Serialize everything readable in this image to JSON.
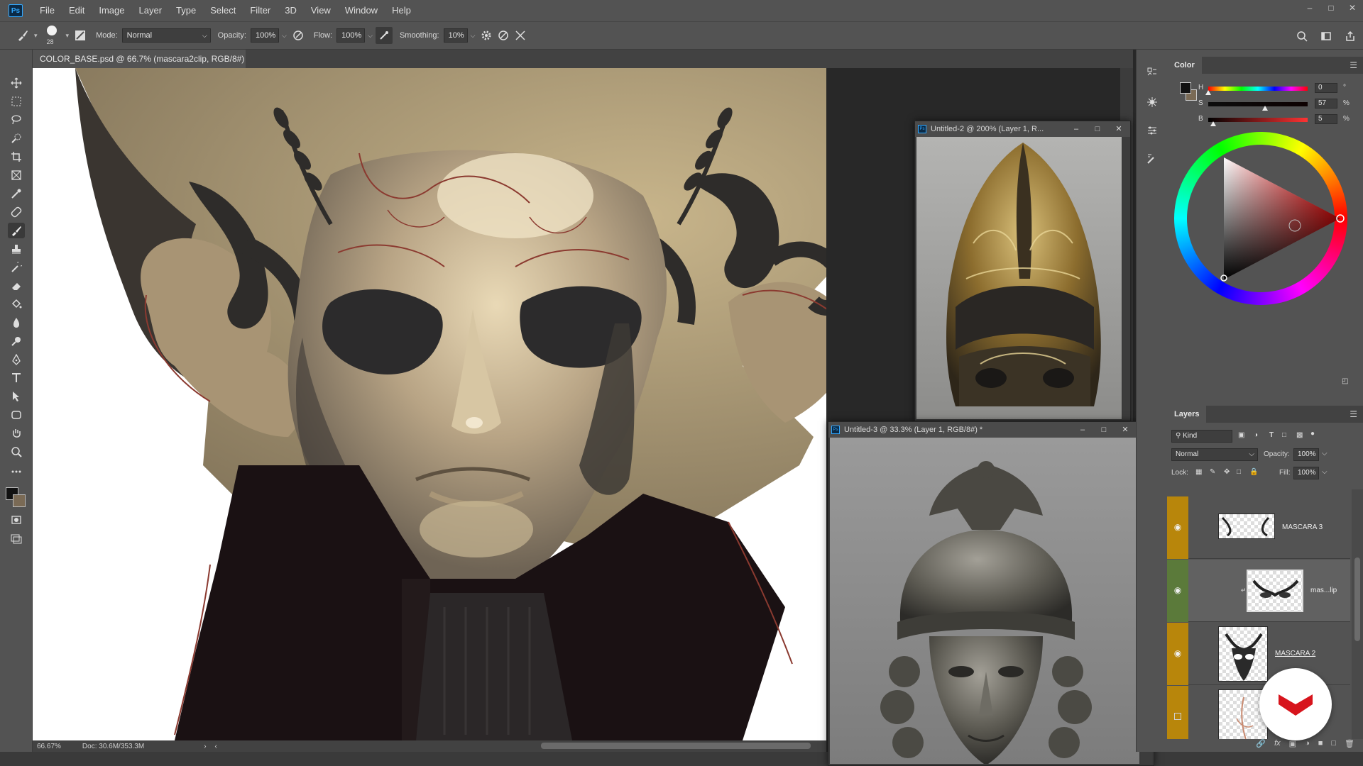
{
  "menubar": {
    "app_logo": "Ps",
    "items": [
      "File",
      "Edit",
      "Image",
      "Layer",
      "Type",
      "Select",
      "Filter",
      "3D",
      "View",
      "Window",
      "Help"
    ]
  },
  "options": {
    "brush_size": "28",
    "mode_label": "Mode:",
    "mode_value": "Normal",
    "opacity_label": "Opacity:",
    "opacity_value": "100%",
    "flow_label": "Flow:",
    "flow_value": "100%",
    "smoothing_label": "Smoothing:",
    "smoothing_value": "10%"
  },
  "document": {
    "tab_title": "COLOR_BASE.psd @ 66.7% (mascara2clip, RGB/8#) *",
    "zoom": "66.67%",
    "doc_size": "Doc: 30.6M/353.3M"
  },
  "ref_windows": [
    {
      "title": "Untitled-2 @ 200% (Layer 1, R..."
    },
    {
      "title": "Untitled-3 @ 33.3% (Layer 1, RGB/8#) *"
    }
  ],
  "color_panel": {
    "tab": "Color",
    "h": {
      "label": "H",
      "value": "0",
      "unit": "°",
      "fraction": 0.0
    },
    "s": {
      "label": "S",
      "value": "57",
      "unit": "%",
      "fraction": 0.57
    },
    "b": {
      "label": "B",
      "value": "5",
      "unit": "%",
      "fraction": 0.05
    },
    "fg_color": "#111111",
    "bg_color": "#7a6a55"
  },
  "layers_panel": {
    "tab": "Layers",
    "filter_kind": "Kind",
    "blend_mode": "Normal",
    "opacity_label": "Opacity:",
    "opacity_value": "100%",
    "lock_label": "Lock:",
    "fill_label": "Fill:",
    "fill_value": "100%",
    "layers": [
      {
        "name": "MASCARA 3",
        "visible": true,
        "color": "#b8860b"
      },
      {
        "name": "mas...lip",
        "visible": true,
        "color": "#5b7a3a"
      },
      {
        "name": "MASCARA 2",
        "visible": true,
        "color": "#b8860b"
      },
      {
        "name": "",
        "visible": false,
        "color": "#b8860b"
      }
    ]
  }
}
